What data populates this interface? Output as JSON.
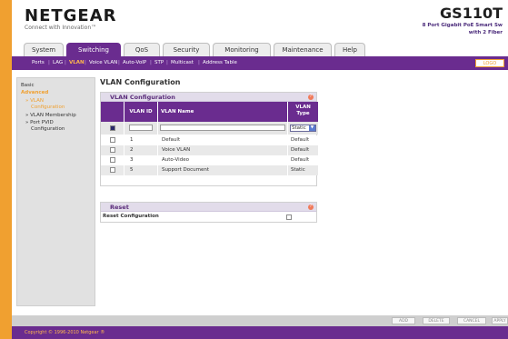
{
  "header": {
    "logo": "NETGEAR",
    "logo_sub": "Connect with Innovation™",
    "product_name": "GS110T",
    "product_desc1": "8 Port Gigabit PoE Smart Sw",
    "product_desc2": "with 2 Fiber"
  },
  "tabs": [
    "System",
    "Switching",
    "QoS",
    "Security",
    "Monitoring",
    "Maintenance",
    "Help"
  ],
  "subnav": [
    "Ports",
    "LAG",
    "VLAN",
    "Voice VLAN",
    "Auto-VoIP",
    "STP",
    "Multicast",
    "Address Table"
  ],
  "logout": "LOGO",
  "sidebar": {
    "basic": "Basic",
    "advanced": "Advanced",
    "vlan_config_1": "» VLAN",
    "vlan_config_2": "Configuration",
    "membership": "» VLAN Membership",
    "pvid_1": "» Port PVID",
    "pvid_2": "Configuration"
  },
  "page_title": "VLAN Configuration",
  "vlan_panel": {
    "title": "VLAN Configuration",
    "help": "?",
    "col_id": "VLAN ID",
    "col_name": "VLAN Name",
    "col_type_1": "VLAN",
    "col_type_2": "Type",
    "input_type": "Static",
    "rows": [
      {
        "id": "1",
        "name": "Default",
        "type": "Default"
      },
      {
        "id": "2",
        "name": "Voice VLAN",
        "type": "Default"
      },
      {
        "id": "3",
        "name": "Auto-Video",
        "type": "Default"
      },
      {
        "id": "5",
        "name": "Support Document",
        "type": "Static"
      }
    ]
  },
  "reset_panel": {
    "title": "Reset",
    "help": "?",
    "label": "Reset Configuration"
  },
  "buttons": [
    "ADD",
    "DELETE",
    "CANCEL",
    "APPLY"
  ],
  "footer": "Copyright © 1996-2010 Netgear ®",
  "colors": {
    "accent": "#6a2c8f",
    "orange": "#f0a030"
  }
}
